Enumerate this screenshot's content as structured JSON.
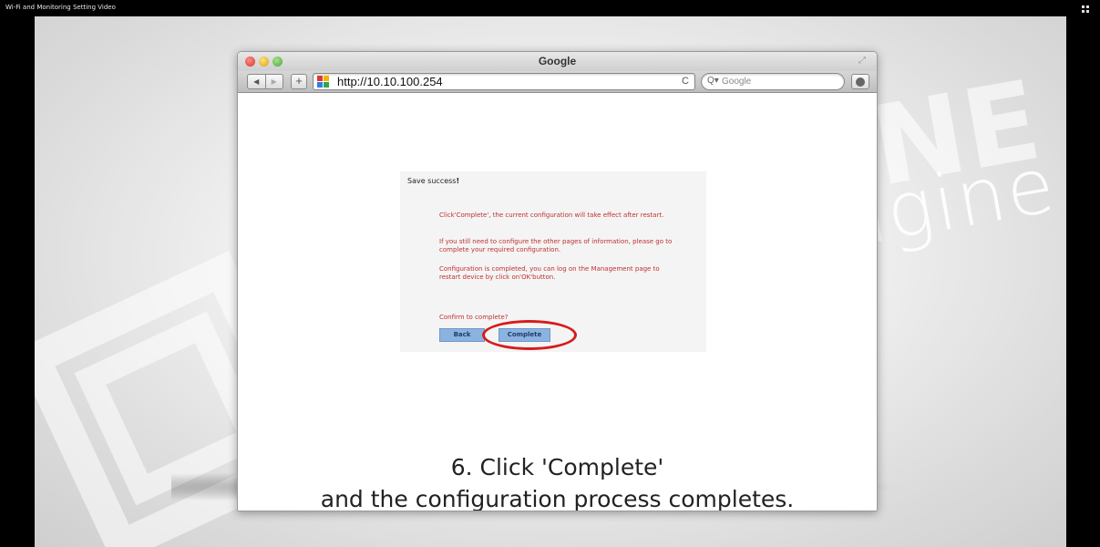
{
  "video": {
    "title": "Wi-Fi and Monitoring Setting Video"
  },
  "browser": {
    "window_title": "Google",
    "url": "http://10.10.100.254",
    "search_placeholder": "Google",
    "back_glyph": "◀",
    "forward_glyph": "▶",
    "add_glyph": "+",
    "reload_glyph": "C",
    "search_glyph": "Q▾"
  },
  "page": {
    "save_status": "Save success",
    "save_status_mark": "!",
    "message_1": "Click'Complete', the current configuration will take effect after restart.",
    "message_2": "If you still need to configure the other pages of information, please go to complete your required configuration.",
    "message_3": "Configuration is completed, you can log on the Management page to restart device by click on'OK'button.",
    "confirm_prompt": "Confirm to complete?",
    "back_label": "Back",
    "complete_label": "Complete"
  },
  "caption": {
    "line1": "6. Click 'Complete'",
    "line2": "and the configuration process completes."
  },
  "colors": {
    "highlight": "#d61b1b",
    "message_text": "#c03030",
    "button_fill": "#8cb3e0"
  }
}
